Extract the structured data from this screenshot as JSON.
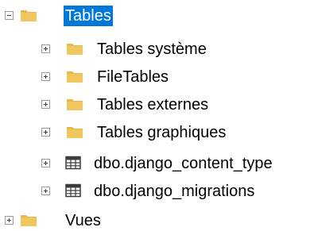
{
  "tree": {
    "root": {
      "label": "Tables",
      "expanded": true,
      "selected": true,
      "icon": "folder-icon"
    },
    "children": [
      {
        "label": "Tables système",
        "icon": "folder-icon",
        "expanded": false
      },
      {
        "label": "FileTables",
        "icon": "folder-icon",
        "expanded": false
      },
      {
        "label": "Tables externes",
        "icon": "folder-icon",
        "expanded": false
      },
      {
        "label": "Tables graphiques",
        "icon": "folder-icon",
        "expanded": false
      },
      {
        "label": "dbo.django_content_type",
        "icon": "table-icon",
        "expanded": false
      },
      {
        "label": "dbo.django_migrations",
        "icon": "table-icon",
        "expanded": false
      }
    ],
    "sibling": {
      "label": "Vues",
      "icon": "folder-icon",
      "expanded": false
    }
  },
  "colors": {
    "folder": "#e8b84a",
    "folder_dark": "#d9a33a",
    "selection": "#0078d7",
    "table_grid": "#3c3c3c"
  }
}
